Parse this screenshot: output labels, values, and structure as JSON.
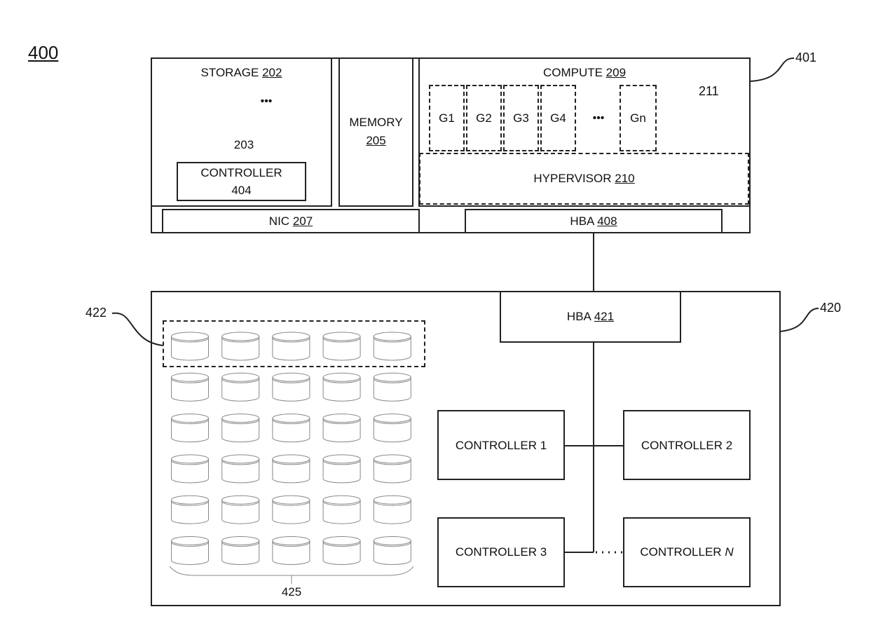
{
  "figure_number": "400",
  "server": {
    "ref": "401",
    "storage": {
      "label": "STORAGE",
      "ref": "202",
      "drives_ref": "203",
      "ellipsis": "•••"
    },
    "storage_controller": {
      "label": "CONTROLLER",
      "ref": "404"
    },
    "memory": {
      "label": "MEMORY",
      "ref": "205"
    },
    "compute": {
      "label": "COMPUTE",
      "ref": "209",
      "guests_ref": "211",
      "ellipsis": "•••",
      "guests": [
        "G1",
        "G2",
        "G3",
        "G4",
        "Gn"
      ]
    },
    "hypervisor": {
      "label": "HYPERVISOR",
      "ref": "210"
    },
    "nic": {
      "label": "NIC",
      "ref": "207"
    },
    "hba": {
      "label": "HBA",
      "ref": "408"
    }
  },
  "enclosure": {
    "ref": "420",
    "group_ref": "422",
    "drives_ref": "425",
    "drive_rows": 6,
    "drive_cols": 5,
    "hba": {
      "label": "HBA",
      "ref": "421"
    },
    "controllers": [
      {
        "label": "CONTROLLER 1"
      },
      {
        "label": "CONTROLLER 2"
      },
      {
        "label": "CONTROLLER 3"
      },
      {
        "label": "CONTROLLER ",
        "suffix": "N"
      }
    ]
  }
}
